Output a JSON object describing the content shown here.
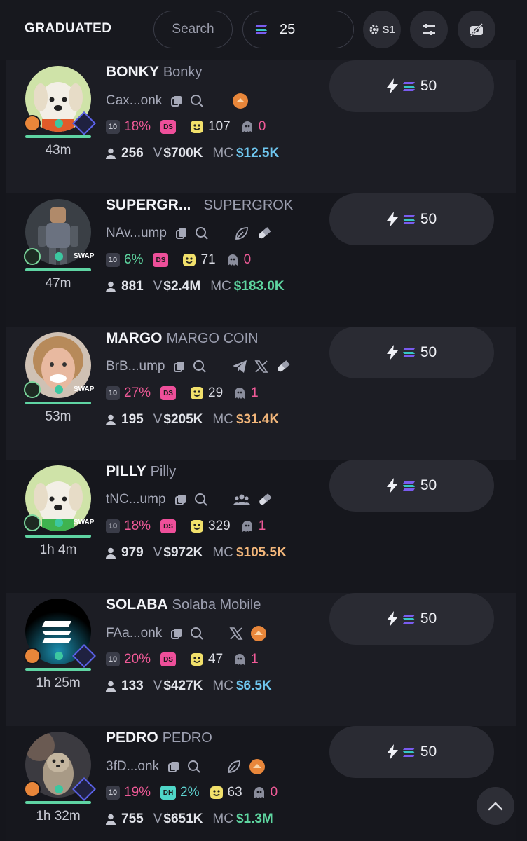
{
  "header": {
    "title": "GRADUATED",
    "search_label": "Search",
    "amount_value": "25",
    "preset_label": "S1"
  },
  "buy_amount": "50",
  "tokens": [
    {
      "ticker": "BONKY",
      "name": "Bonky",
      "address": "Cax...onk",
      "top10": "10",
      "top10_pct": "18%",
      "dev_tag": "DS",
      "holders_smile": "107",
      "ghost": "0",
      "holders": "256",
      "volume": "$700K",
      "mc": "$12.5K",
      "age": "43m"
    },
    {
      "ticker": "SUPERGR...",
      "name": "SUPERGROK",
      "address": "NAv...ump",
      "top10": "10",
      "top10_pct": "6%",
      "dev_tag": "DS",
      "holders_smile": "71",
      "ghost": "0",
      "holders": "881",
      "volume": "$2.4M",
      "mc": "$183.0K",
      "age": "47m"
    },
    {
      "ticker": "MARGO",
      "name": "MARGO COIN",
      "address": "BrB...ump",
      "top10": "10",
      "top10_pct": "27%",
      "dev_tag": "DS",
      "holders_smile": "29",
      "ghost": "1",
      "holders": "195",
      "volume": "$205K",
      "mc": "$31.4K",
      "age": "53m"
    },
    {
      "ticker": "PILLY",
      "name": "Pilly",
      "address": "tNC...ump",
      "top10": "10",
      "top10_pct": "18%",
      "dev_tag": "DS",
      "holders_smile": "329",
      "ghost": "1",
      "holders": "979",
      "volume": "$972K",
      "mc": "$105.5K",
      "age": "1h 4m"
    },
    {
      "ticker": "SOLABA",
      "name": "Solaba Mobile",
      "address": "FAa...onk",
      "top10": "10",
      "top10_pct": "20%",
      "dev_tag": "DS",
      "holders_smile": "47",
      "ghost": "1",
      "holders": "133",
      "volume": "$427K",
      "mc": "$6.5K",
      "age": "1h 25m"
    },
    {
      "ticker": "PEDRO",
      "name": "PEDRO",
      "address": "3fD...onk",
      "top10": "10",
      "top10_pct": "19%",
      "dev_tag": "DH",
      "dev_pct": "2%",
      "holders_smile": "63",
      "ghost": "0",
      "holders": "755",
      "volume": "$651K",
      "mc": "$1.3M",
      "age": "1h 32m"
    }
  ],
  "labels": {
    "volume_prefix": "V",
    "mc_prefix": "MC",
    "swap": "SWAP"
  },
  "colors": {
    "background": "#15161c",
    "progress": "#5fd4a3",
    "pink": "#ef5a97",
    "mc_blue": "#6fc7f0",
    "mc_green": "#5ed6a0",
    "mc_orange": "#f2b67a"
  }
}
